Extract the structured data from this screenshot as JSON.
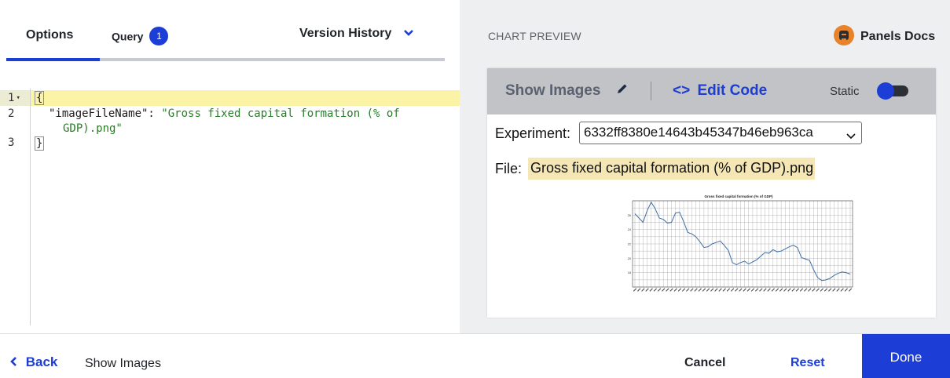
{
  "tabs": {
    "options_label": "Options",
    "query_label": "Query",
    "query_badge": "1",
    "version_history_label": "Version History"
  },
  "editor": {
    "line_numbers": [
      "1",
      "2",
      "3"
    ],
    "line1": "{",
    "line2_key": "\"imageFileName\": ",
    "line2_value_a": "\"Gross fixed capital formation (% of",
    "line2_value_b": "GDP).png\"",
    "line3": "}"
  },
  "preview": {
    "title": "CHART PREVIEW",
    "docs_label": "Panels Docs",
    "show_images_label": "Show Images",
    "edit_code_label": "Edit Code",
    "static_label": "Static",
    "static_enabled": true,
    "experiment_label": "Experiment:",
    "experiment_value": "6332ff8380e14643b45347b46eb963ca",
    "file_label": "File:",
    "file_value": "Gross fixed capital formation (% of GDP).png"
  },
  "chart_data": {
    "type": "line",
    "title": "Gross fixed capital formation (% of GDP)",
    "xlabel": "",
    "ylabel": "",
    "ylim": [
      16,
      28
    ],
    "y_ticks": [
      18,
      20,
      22,
      24,
      26
    ],
    "grid": true,
    "series": [
      {
        "color": "#3f6fa8",
        "values": [
          26.2,
          25.6,
          25.0,
          26.6,
          27.8,
          26.9,
          25.6,
          25.4,
          24.9,
          25.0,
          26.3,
          26.4,
          25.1,
          23.6,
          23.4,
          23.0,
          22.3,
          21.5,
          21.6,
          22.0,
          22.2,
          22.4,
          21.8,
          21.1,
          19.4,
          19.1,
          19.4,
          19.6,
          19.2,
          19.5,
          19.8,
          20.3,
          20.8,
          20.7,
          21.2,
          20.9,
          21.0,
          21.3,
          21.6,
          21.8,
          21.5,
          20.1,
          19.9,
          19.7,
          18.4,
          17.3,
          16.9,
          17.0,
          17.2,
          17.6,
          17.9,
          18.1,
          18.0,
          17.8
        ]
      }
    ]
  },
  "footer": {
    "back_label": "Back",
    "breadcrumb_label": "Show Images",
    "cancel_label": "Cancel",
    "reset_label": "Reset",
    "done_label": "Done"
  }
}
